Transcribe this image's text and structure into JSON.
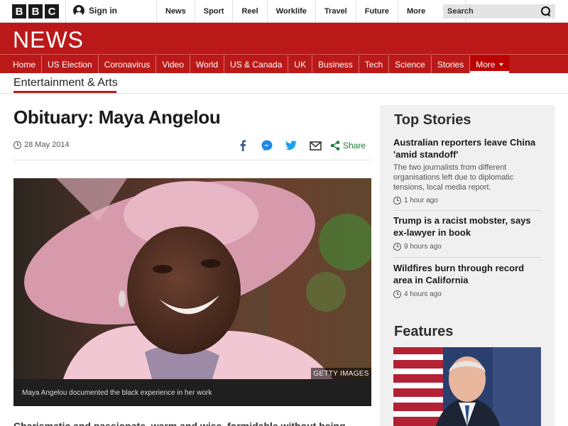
{
  "masthead": {
    "logo_letters": [
      "B",
      "B",
      "C"
    ],
    "signin_label": "Sign in",
    "nav": [
      "News",
      "Sport",
      "Reel",
      "Worklife",
      "Travel",
      "Future"
    ],
    "more_label": "More",
    "search_placeholder": "Search"
  },
  "news_header": {
    "brand": "NEWS",
    "nav": [
      "Home",
      "US Election",
      "Coronavirus",
      "Video",
      "World",
      "US & Canada",
      "UK",
      "Business",
      "Tech",
      "Science",
      "Stories"
    ],
    "more_label": "More",
    "brand_color": "#bb1919"
  },
  "section": {
    "title": "Entertainment & Arts"
  },
  "article": {
    "headline": "Obituary: Maya Angelou",
    "date": "28 May 2014",
    "share_label": "Share",
    "share_icons": [
      "facebook-icon",
      "messenger-icon",
      "twitter-icon",
      "email-icon",
      "share-icon"
    ],
    "image_credit": "GETTY IMAGES",
    "caption": "Maya Angelou documented the black experience in her work",
    "body_start": "Charismatic and passionate, warm and wise, formidable without being"
  },
  "sidebar": {
    "top_stories_title": "Top Stories",
    "stories": [
      {
        "headline": "Australian reporters leave China 'amid standoff'",
        "summary": "The two journalists from different organisations left due to diplomatic tensions, local media report.",
        "time": "1 hour ago"
      },
      {
        "headline": "Trump is a racist mobster, says ex-lawyer in book",
        "summary": "",
        "time": "9 hours ago"
      },
      {
        "headline": "Wildfires burn through record area in California",
        "summary": "",
        "time": "4 hours ago"
      }
    ],
    "features_title": "Features"
  }
}
